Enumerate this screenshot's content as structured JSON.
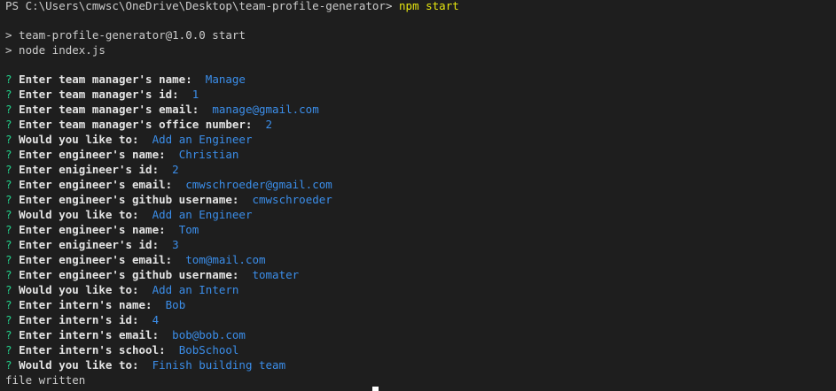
{
  "terminal": {
    "prompt": "PS C:\\Users\\cmwsc\\OneDrive\\Desktop\\team-profile-generator>",
    "command": "npm start",
    "npm_output": [
      "> team-profile-generator@1.0.0 start",
      "> node index.js"
    ],
    "qa": [
      {
        "mark": "?",
        "question": "Enter team manager's name:",
        "answer": "Manage"
      },
      {
        "mark": "?",
        "question": "Enter team manager's id:",
        "answer": "1"
      },
      {
        "mark": "?",
        "question": "Enter team manager's email:",
        "answer": "manage@gmail.com"
      },
      {
        "mark": "?",
        "question": "Enter team manager's office number:",
        "answer": "2"
      },
      {
        "mark": "?",
        "question": "Would you like to:",
        "answer": "Add an Engineer"
      },
      {
        "mark": "?",
        "question": "Enter engineer's name:",
        "answer": "Christian"
      },
      {
        "mark": "?",
        "question": "Enter enigineer's id:",
        "answer": "2"
      },
      {
        "mark": "?",
        "question": "Enter engineer's email:",
        "answer": "cmwschroeder@gmail.com"
      },
      {
        "mark": "?",
        "question": "Enter engineer's github username:",
        "answer": "cmwschroeder"
      },
      {
        "mark": "?",
        "question": "Would you like to:",
        "answer": "Add an Engineer"
      },
      {
        "mark": "?",
        "question": "Enter engineer's name:",
        "answer": "Tom"
      },
      {
        "mark": "?",
        "question": "Enter enigineer's id:",
        "answer": "3"
      },
      {
        "mark": "?",
        "question": "Enter engineer's email:",
        "answer": "tom@mail.com"
      },
      {
        "mark": "?",
        "question": "Enter engineer's github username:",
        "answer": "tomater"
      },
      {
        "mark": "?",
        "question": "Would you like to:",
        "answer": "Add an Intern"
      },
      {
        "mark": "?",
        "question": "Enter intern's name:",
        "answer": "Bob"
      },
      {
        "mark": "?",
        "question": "Enter intern's id:",
        "answer": "4"
      },
      {
        "mark": "?",
        "question": "Enter intern's email:",
        "answer": "bob@bob.com"
      },
      {
        "mark": "?",
        "question": "Enter intern's school:",
        "answer": "BobSchool"
      },
      {
        "mark": "?",
        "question": "Would you like to:",
        "answer": "Finish building team"
      }
    ],
    "final_output": "file written"
  },
  "colors": {
    "background": "#1e1e1e",
    "text": "#cccccc",
    "question_mark": "#23d18b",
    "answer": "#3b8eea",
    "command": "#e5e510"
  }
}
